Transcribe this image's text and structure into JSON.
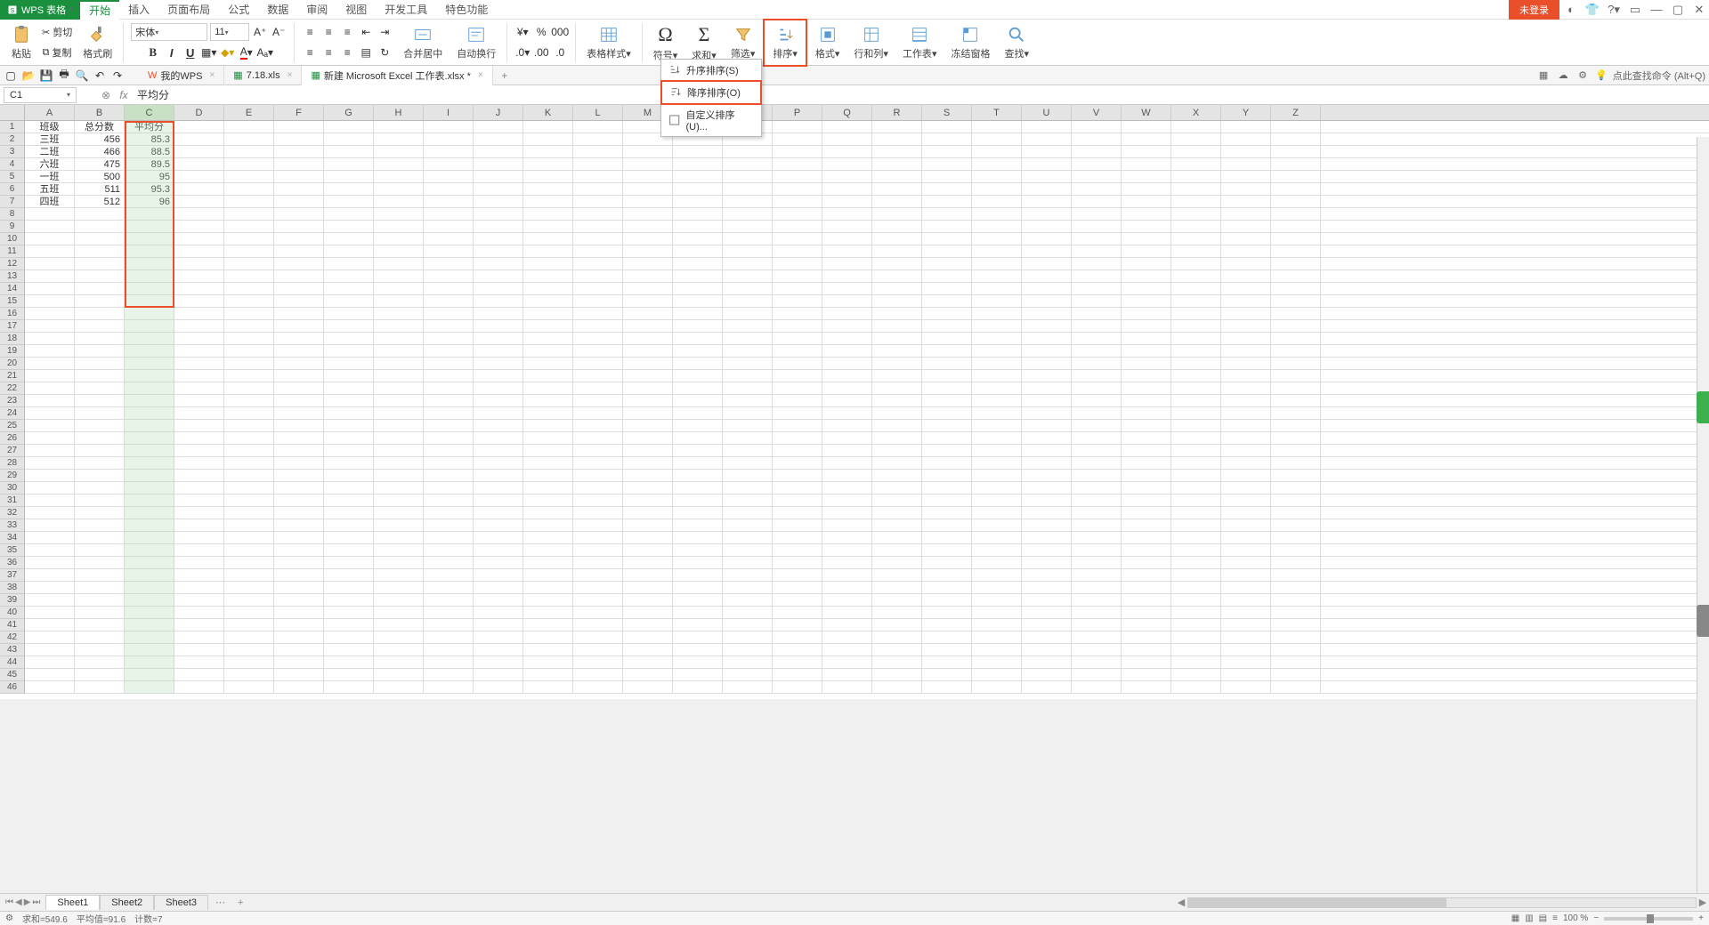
{
  "app": {
    "name": "WPS 表格"
  },
  "menus": [
    "开始",
    "插入",
    "页面布局",
    "公式",
    "数据",
    "审阅",
    "视图",
    "开发工具",
    "特色功能"
  ],
  "active_menu": 0,
  "titlebar_right": {
    "not_logged": "未登录"
  },
  "ribbon": {
    "paste": "粘贴",
    "cut": "剪切",
    "copy": "复制",
    "fmtpaint": "格式刷",
    "font": "宋体",
    "fontsize": "11",
    "merge": "合并居中",
    "wrap": "自动换行",
    "tablestyle": "表格样式",
    "symbol": "符号",
    "sum": "求和",
    "filter": "筛选",
    "sort": "排序",
    "format": "格式",
    "rowcol": "行和列",
    "worksheet": "工作表",
    "freeze": "冻结窗格",
    "find": "查找"
  },
  "sort_menu": {
    "asc": "升序排序(S)",
    "desc": "降序排序(O)",
    "custom": "自定义排序(U)..."
  },
  "qatabs": [
    {
      "icon": "wps",
      "label": "我的WPS",
      "close": "×"
    },
    {
      "icon": "xls",
      "label": "7.18.xls",
      "close": "×",
      "suffix": "*"
    },
    {
      "icon": "xls",
      "label": "新建 Microsoft Excel 工作表.xlsx *",
      "close": "×",
      "active": true
    }
  ],
  "qabar_right_hint": "点此查找命令 (Alt+Q)",
  "namebox": "C1",
  "formula": "平均分",
  "columns": [
    "A",
    "B",
    "C",
    "D",
    "E",
    "F",
    "G",
    "H",
    "I",
    "J",
    "K",
    "L",
    "M",
    "N",
    "O",
    "P",
    "Q",
    "R",
    "S",
    "T",
    "U",
    "V",
    "W",
    "X",
    "Y",
    "Z"
  ],
  "rows_count": 46,
  "data_rows": [
    [
      "班级",
      "总分数",
      "平均分"
    ],
    [
      "三班",
      "456",
      "85.3"
    ],
    [
      "二班",
      "466",
      "88.5"
    ],
    [
      "六班",
      "475",
      "89.5"
    ],
    [
      "一班",
      "500",
      "95"
    ],
    [
      "五班",
      "511",
      "95.3"
    ],
    [
      "四班",
      "512",
      "96"
    ]
  ],
  "sheets": [
    "Sheet1",
    "Sheet2",
    "Sheet3"
  ],
  "active_sheet": 0,
  "status": {
    "sum": "求和=549.6",
    "avg": "平均值=91.6",
    "count": "计数=7",
    "zoom": "100 %"
  }
}
